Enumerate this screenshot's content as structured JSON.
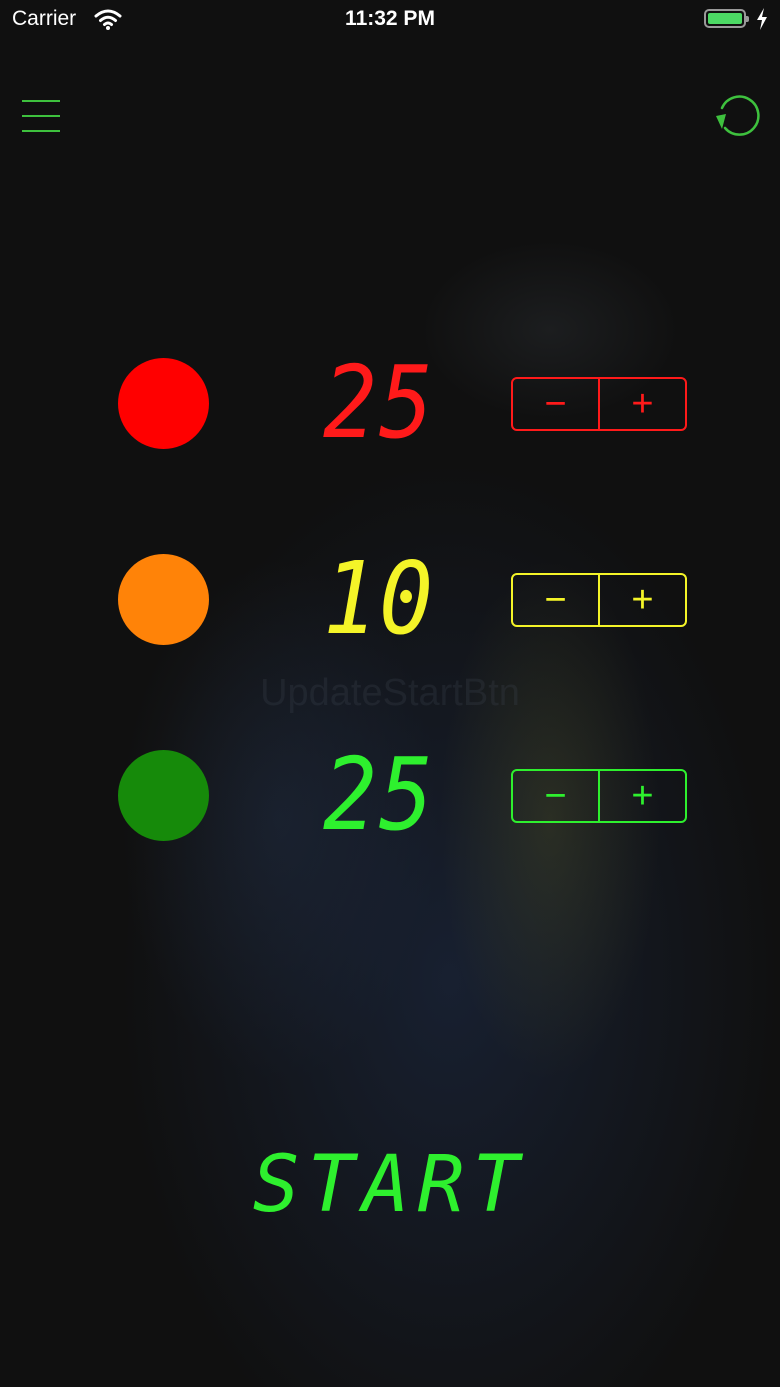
{
  "status_bar": {
    "carrier": "Carrier",
    "time": "11:32 PM",
    "battery_icon": "battery-full-icon",
    "charging_icon": "charging-bolt-icon",
    "wifi_icon": "wifi-icon"
  },
  "header": {
    "menu_icon": "hamburger-menu-icon",
    "reset_icon": "refresh-icon",
    "accent_color": "#3ec13e"
  },
  "lights": [
    {
      "name": "red",
      "light_color": "#ff0000",
      "digit_color": "#ff1a1a",
      "value": "25",
      "minus": "−",
      "plus": "+"
    },
    {
      "name": "yellow",
      "light_color": "#ff8308",
      "digit_color": "#f4f428",
      "value": "10",
      "minus": "−",
      "plus": "+"
    },
    {
      "name": "green",
      "light_color": "#168a0a",
      "digit_color": "#2ef02e",
      "value": "25",
      "minus": "−",
      "plus": "+"
    }
  ],
  "ghost_label": "UpdateStartBtn",
  "start_label": "START"
}
